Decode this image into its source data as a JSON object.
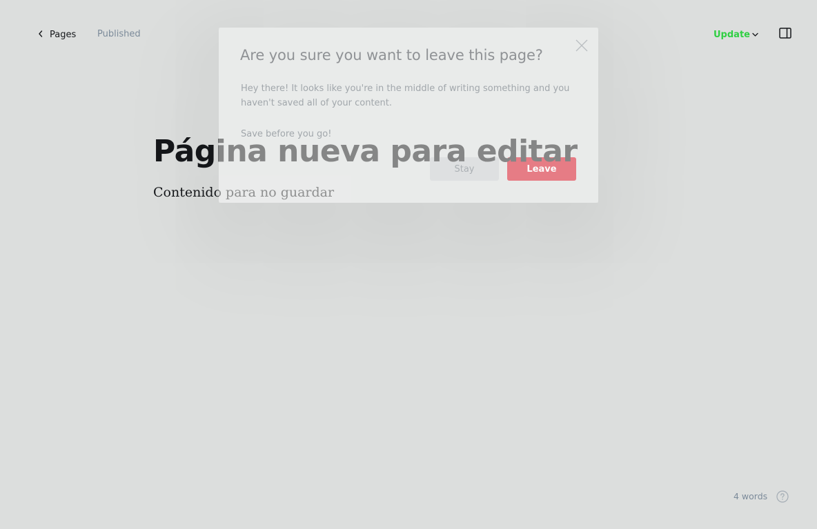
{
  "header": {
    "back_label": "Pages",
    "status": "Published",
    "update_label": "Update"
  },
  "editor": {
    "title": "Página nueva para editar",
    "body": "Contenido para no guardar"
  },
  "footer": {
    "word_count": "4 words"
  },
  "modal": {
    "title": "Are you sure you want to leave this page?",
    "message": "Hey there! It looks like you're in the middle of writing something and you haven't saved all of your content.",
    "message2": "Save before you go!",
    "stay_label": "Stay",
    "leave_label": "Leave"
  },
  "colors": {
    "accent_green": "#30cf43",
    "leave_red": "#e7757f",
    "background": "#dcdedd"
  }
}
